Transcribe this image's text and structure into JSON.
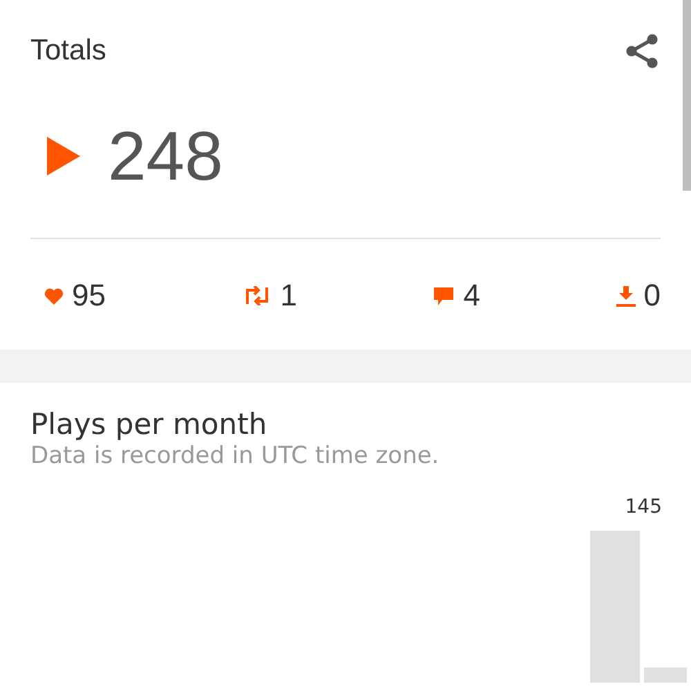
{
  "totals": {
    "title": "Totals",
    "plays": "248",
    "stats": [
      {
        "kind": "likes",
        "value": "95"
      },
      {
        "kind": "reposts",
        "value": "1"
      },
      {
        "kind": "comments",
        "value": "4"
      },
      {
        "kind": "downloads",
        "value": "0"
      }
    ]
  },
  "plays_per_month": {
    "title": "Plays per month",
    "note": "Data is recorded in UTC time zone.",
    "peak_label": "145"
  }
}
